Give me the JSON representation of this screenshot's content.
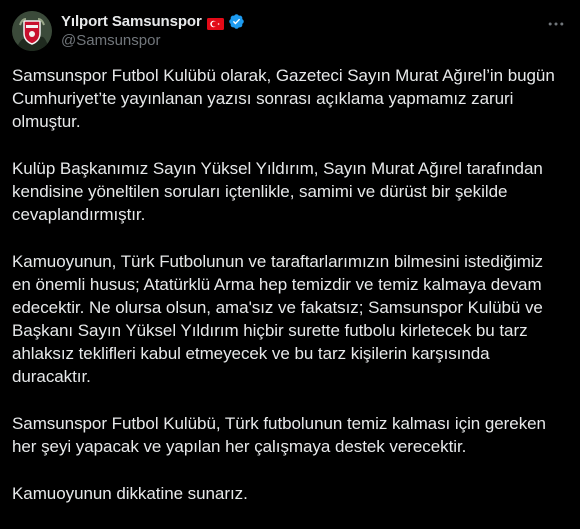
{
  "account": {
    "display_name": "Yılport Samsunspor",
    "handle": "@Samsunspor",
    "flag_icon": "turkey-flag-icon",
    "verified_icon": "verified-badge-icon",
    "more_icon": "more-options-icon"
  },
  "colors": {
    "background": "#000000",
    "text": "#e7e9ea",
    "secondary_text": "#71767b",
    "verified": "#1d9bf0",
    "flag_red": "#e30a17"
  },
  "tweet": {
    "paragraphs": [
      "Samsunspor Futbol Kulübü olarak, Gazeteci Sayın Murat Ağırel’in bugün\nCumhuriyet’te yayınlanan yazısı sonrası açıklama yapmamız zaruri\nolmuştur.",
      "Kulüp Başkanımız Sayın Yüksel Yıldırım, Sayın Murat Ağırel tarafından\nkendisine yöneltilen soruları içtenlikle, samimi ve dürüst bir şekilde\ncevaplandırmıştır.",
      "Kamuoyunun, Türk Futbolunun ve taraftarlarımızın bilmesini istediğimiz\nen önemli husus; Atatürklü Arma hep temizdir ve temiz kalmaya devam\nedecektir. Ne olursa olsun, ama'sız ve fakatsız; Samsunspor Kulübü ve\nBaşkanı Sayın Yüksel Yıldırım hiçbir surette futbolu kirletecek bu tarz\nahlaksız teklifleri kabul etmeyecek ve bu tarz kişilerin karşısında\nduracaktır.",
      "Samsunspor Futbol Kulübü, Türk futbolunun temiz kalması için gereken\nher şeyi yapacak ve yapılan her çalışmaya destek verecektir.",
      "Kamuoyunun dikkatine sunarız."
    ]
  }
}
